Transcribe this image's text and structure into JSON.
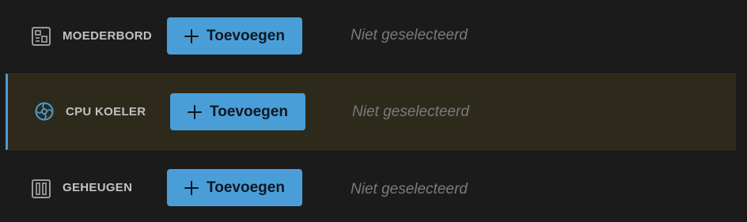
{
  "components": [
    {
      "label": "MOEDERBORD",
      "icon": "motherboard-icon",
      "button_label": "Toevoegen",
      "status": "Niet geselecteerd"
    },
    {
      "label": "CPU KOELER",
      "icon": "cpu-cooler-icon",
      "button_label": "Toevoegen",
      "status": "Niet geselecteerd"
    },
    {
      "label": "GEHEUGEN",
      "icon": "memory-icon",
      "button_label": "Toevoegen",
      "status": "Niet geselecteerd"
    }
  ],
  "colors": {
    "background": "#1b1b1b",
    "highlight_row": "#2d2a1c",
    "accent": "#4a9ed8",
    "label": "#c2c2c2",
    "status": "#7a7a7a"
  }
}
